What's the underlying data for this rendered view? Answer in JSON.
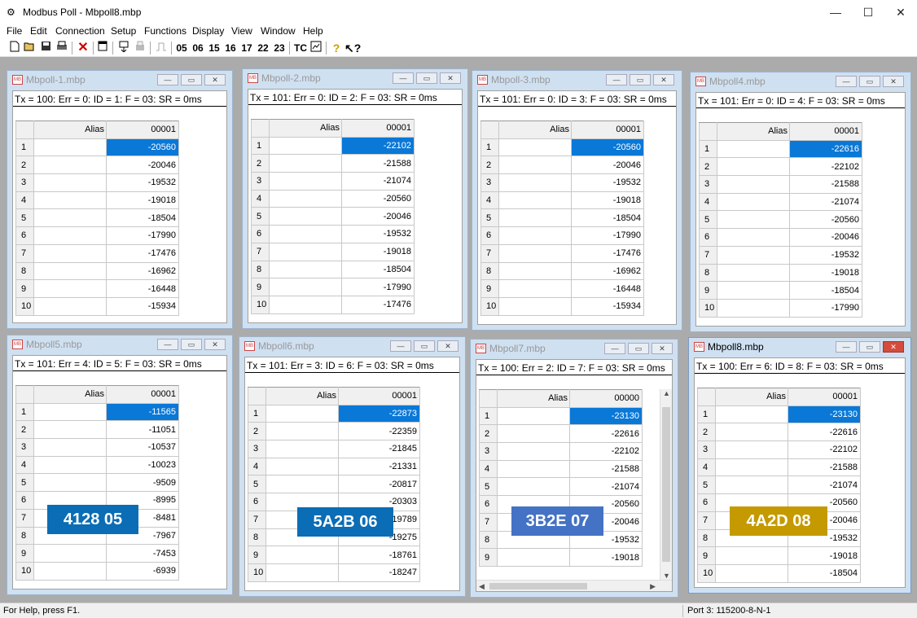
{
  "window": {
    "title": "Modbus Poll - Mbpoll8.mbp",
    "minimize_glyph": "—",
    "maximize_glyph": "☐",
    "close_glyph": "✕"
  },
  "menu": [
    "File",
    "Edit",
    "Connection",
    "Setup",
    "Functions",
    "Display",
    "View",
    "Window",
    "Help"
  ],
  "toolbar": {
    "function_codes": [
      "05",
      "06",
      "15",
      "16",
      "17",
      "22",
      "23"
    ],
    "tc_label": "TC"
  },
  "children": [
    {
      "title": "Mbpoll-1.mbp",
      "status": "Tx = 100: Err = 0: ID = 1: F = 03: SR = 0ms",
      "alias_header": "Alias",
      "col_header": "00001",
      "rows": [
        "1",
        "2",
        "3",
        "4",
        "5",
        "6",
        "7",
        "8",
        "9",
        "10"
      ],
      "values": [
        "-20560",
        "-20046",
        "-19532",
        "-19018",
        "-18504",
        "-17990",
        "-17476",
        "-16962",
        "-16448",
        "-15934"
      ]
    },
    {
      "title": "Mbpoll-2.mbp",
      "status": "Tx = 101: Err = 0: ID = 2: F = 03: SR = 0ms",
      "alias_header": "Alias",
      "col_header": "00001",
      "rows": [
        "1",
        "2",
        "3",
        "4",
        "5",
        "6",
        "7",
        "8",
        "9",
        "10"
      ],
      "values": [
        "-22102",
        "-21588",
        "-21074",
        "-20560",
        "-20046",
        "-19532",
        "-19018",
        "-18504",
        "-17990",
        "-17476"
      ]
    },
    {
      "title": "Mbpoll-3.mbp",
      "status": "Tx = 101: Err = 0: ID = 3: F = 03: SR = 0ms",
      "alias_header": "Alias",
      "col_header": "00001",
      "rows": [
        "1",
        "2",
        "3",
        "4",
        "5",
        "6",
        "7",
        "8",
        "9",
        "10"
      ],
      "values": [
        "-20560",
        "-20046",
        "-19532",
        "-19018",
        "-18504",
        "-17990",
        "-17476",
        "-16962",
        "-16448",
        "-15934"
      ]
    },
    {
      "title": "Mbpoll4.mbp",
      "status": "Tx = 101: Err = 0: ID = 4: F = 03: SR = 0ms",
      "alias_header": "Alias",
      "col_header": "00001",
      "rows": [
        "1",
        "2",
        "3",
        "4",
        "5",
        "6",
        "7",
        "8",
        "9",
        "10"
      ],
      "values": [
        "-22616",
        "-22102",
        "-21588",
        "-21074",
        "-20560",
        "-20046",
        "-19532",
        "-19018",
        "-18504",
        "-17990"
      ]
    },
    {
      "title": "Mbpoll5.mbp",
      "status": "Tx = 101: Err = 4: ID = 5: F = 03: SR = 0ms",
      "alias_header": "Alias",
      "col_header": "00001",
      "rows": [
        "1",
        "2",
        "3",
        "4",
        "5",
        "6",
        "7",
        "8",
        "9",
        "10"
      ],
      "values": [
        "-11565",
        "-11051",
        "-10537",
        "-10023",
        "-9509",
        "-8995",
        "-8481",
        "-7967",
        "-7453",
        "-6939"
      ],
      "label": "4128  05"
    },
    {
      "title": "Mbpoll6.mbp",
      "status": "Tx = 101: Err = 3: ID = 6: F = 03: SR = 0ms",
      "alias_header": "Alias",
      "col_header": "00001",
      "rows": [
        "1",
        "2",
        "3",
        "4",
        "5",
        "6",
        "7",
        "8",
        "9",
        "10"
      ],
      "values": [
        "-22873",
        "-22359",
        "-21845",
        "-21331",
        "-20817",
        "-20303",
        "-19789",
        "-19275",
        "-18761",
        "-18247"
      ],
      "label": "5A2B  06"
    },
    {
      "title": "Mbpoll7.mbp",
      "status": "Tx = 100: Err = 2: ID = 7: F = 03: SR = 0ms",
      "alias_header": "Alias",
      "col_header": "00000",
      "rows": [
        "1",
        "2",
        "3",
        "4",
        "5",
        "6",
        "7",
        "8",
        "9"
      ],
      "values": [
        "-23130",
        "-22616",
        "-22102",
        "-21588",
        "-21074",
        "-20560",
        "-20046",
        "-19532",
        "-19018"
      ],
      "label": "3B2E  07"
    },
    {
      "title": "Mbpoll8.mbp",
      "status": "Tx = 100: Err = 6: ID = 8: F = 03: SR = 0ms",
      "alias_header": "Alias",
      "col_header": "00001",
      "rows": [
        "1",
        "2",
        "3",
        "4",
        "5",
        "6",
        "7",
        "8",
        "9",
        "10"
      ],
      "values": [
        "-23130",
        "-22616",
        "-22102",
        "-21588",
        "-21074",
        "-20560",
        "-20046",
        "-19532",
        "-19018",
        "-18504"
      ],
      "label": "4A2D  08"
    }
  ],
  "colors": {
    "selection": "#0a78d7",
    "label_blue": "#0a6db5",
    "label_periwinkle": "#4472c4",
    "label_gold": "#c49a00"
  },
  "statusbar": {
    "help": "For Help, press F1.",
    "port": "Port 3: 115200-8-N-1"
  }
}
